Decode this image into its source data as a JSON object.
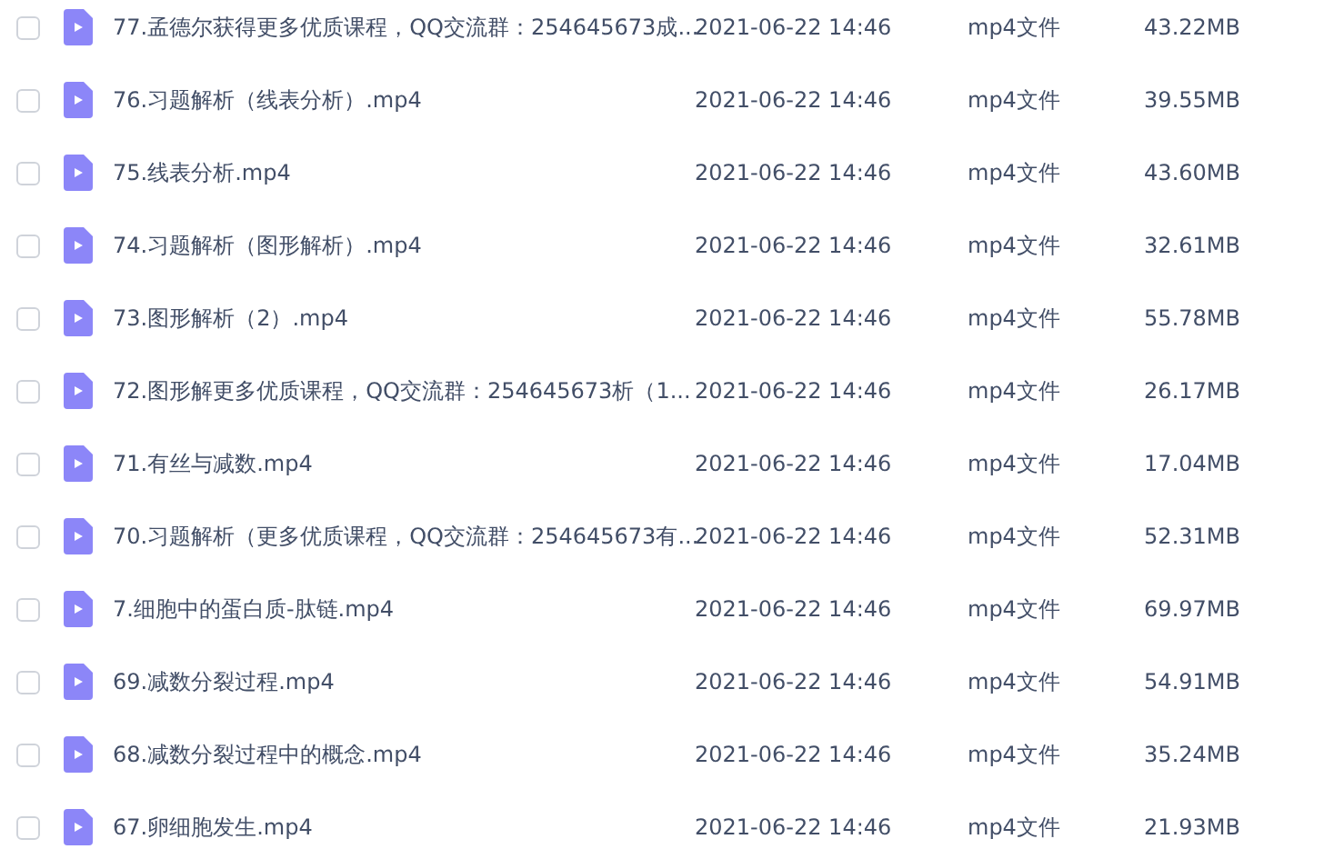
{
  "files": [
    {
      "checked": false,
      "name": "77.孟德尔获得更多优质课程，QQ交流群：254645673成...",
      "date": "2021-06-22 14:46",
      "type": "mp4文件",
      "size": "43.22MB"
    },
    {
      "checked": false,
      "name": "76.习题解析（线表分析）.mp4",
      "date": "2021-06-22 14:46",
      "type": "mp4文件",
      "size": "39.55MB"
    },
    {
      "checked": false,
      "name": "75.线表分析.mp4",
      "date": "2021-06-22 14:46",
      "type": "mp4文件",
      "size": "43.60MB"
    },
    {
      "checked": false,
      "name": "74.习题解析（图形解析）.mp4",
      "date": "2021-06-22 14:46",
      "type": "mp4文件",
      "size": "32.61MB"
    },
    {
      "checked": false,
      "name": "73.图形解析（2）.mp4",
      "date": "2021-06-22 14:46",
      "type": "mp4文件",
      "size": "55.78MB"
    },
    {
      "checked": false,
      "name": "72.图形解更多优质课程，QQ交流群：254645673析（1...",
      "date": "2021-06-22 14:46",
      "type": "mp4文件",
      "size": "26.17MB"
    },
    {
      "checked": false,
      "name": "71.有丝与减数.mp4",
      "date": "2021-06-22 14:46",
      "type": "mp4文件",
      "size": "17.04MB"
    },
    {
      "checked": false,
      "name": "70.习题解析（更多优质课程，QQ交流群：254645673有...",
      "date": "2021-06-22 14:46",
      "type": "mp4文件",
      "size": "52.31MB"
    },
    {
      "checked": false,
      "name": "7.细胞中的蛋白质-肽链.mp4",
      "date": "2021-06-22 14:46",
      "type": "mp4文件",
      "size": "69.97MB"
    },
    {
      "checked": false,
      "name": "69.减数分裂过程.mp4",
      "date": "2021-06-22 14:46",
      "type": "mp4文件",
      "size": "54.91MB"
    },
    {
      "checked": false,
      "name": "68.减数分裂过程中的概念.mp4",
      "date": "2021-06-22 14:46",
      "type": "mp4文件",
      "size": "35.24MB"
    },
    {
      "checked": false,
      "name": "67.卵细胞发生.mp4",
      "date": "2021-06-22 14:46",
      "type": "mp4文件",
      "size": "21.93MB"
    }
  ]
}
